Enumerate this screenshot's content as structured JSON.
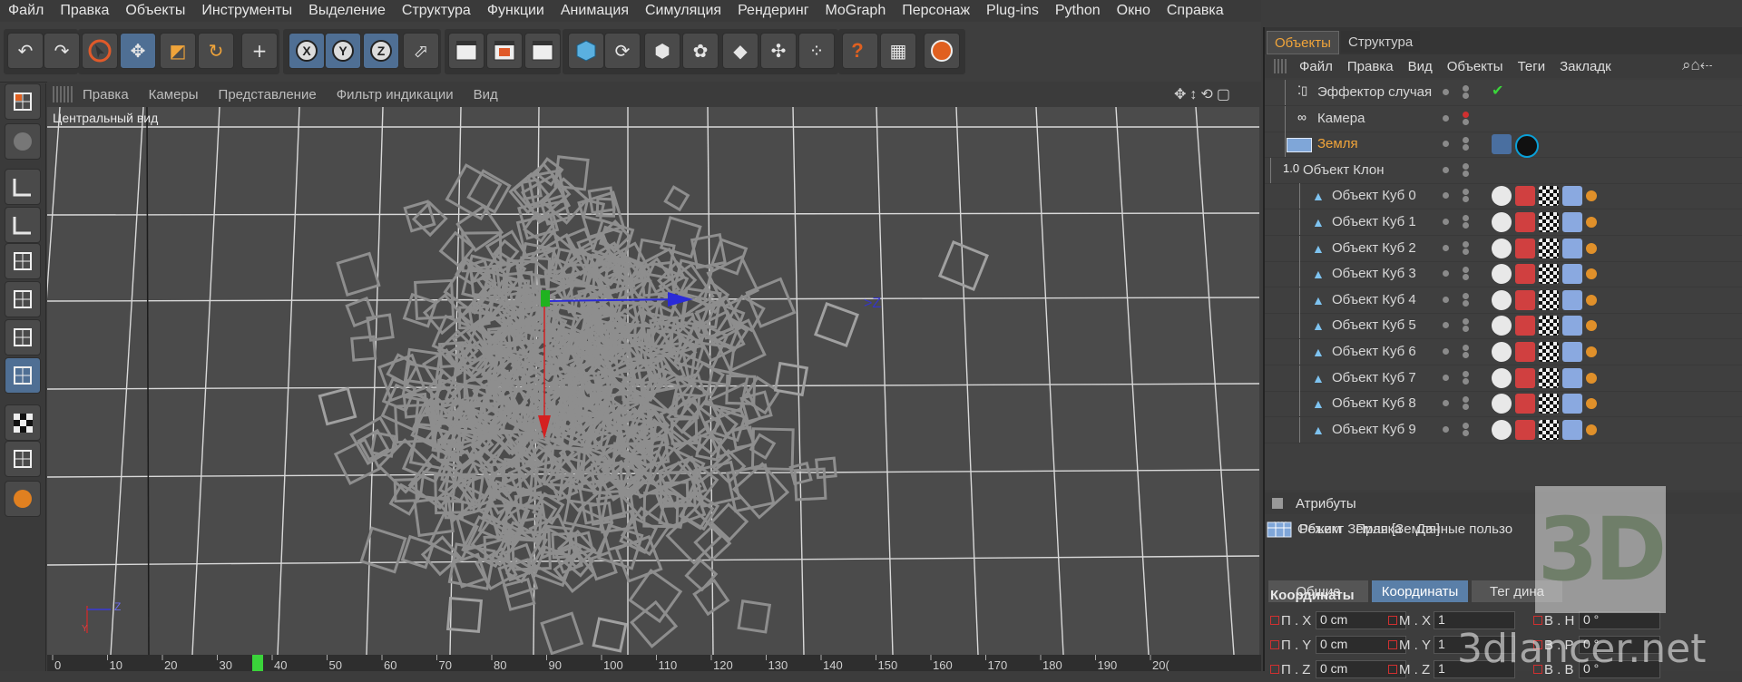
{
  "menubar": [
    "Файл",
    "Правка",
    "Объекты",
    "Инструменты",
    "Выделение",
    "Структура",
    "Функции",
    "Анимация",
    "Симуляция",
    "Рендеринг",
    "MoGraph",
    "Персонаж",
    "Plug-ins",
    "Python",
    "Окно",
    "Справка"
  ],
  "toolbar_icons": [
    "undo-icon",
    "redo-icon",
    "select-icon",
    "move-icon",
    "scale-icon",
    "rotate-icon",
    "add-icon",
    "x-axis-icon",
    "y-axis-icon",
    "z-axis-icon",
    "coordinate-system-icon",
    "render-view-icon",
    "render-picture-viewer-icon",
    "render-settings-icon",
    "cube-icon",
    "spline-icon",
    "nurbs-icon",
    "array-icon",
    "deformer-icon",
    "scene-icon",
    "particles-icon",
    "help-icon",
    "table-icon",
    "globe-icon"
  ],
  "viewport": {
    "menu": [
      "Правка",
      "Камеры",
      "Представление",
      "Фильтр индикации",
      "Вид"
    ],
    "label": "Центральный вид",
    "axis_gizmo": {
      "y": "Y",
      "z": "Z"
    }
  },
  "timeline": {
    "ticks": [
      "0",
      "10",
      "20",
      "30",
      "40",
      "50",
      "60",
      "70",
      "80",
      "90",
      "100",
      "110",
      "120",
      "130",
      "140",
      "150",
      "160",
      "170",
      "180",
      "190",
      "20("
    ],
    "current_frame_marker": "green"
  },
  "objects_panel": {
    "tabs": [
      "Объекты",
      "Структура"
    ],
    "menu": [
      "Файл",
      "Правка",
      "Вид",
      "Объекты",
      "Теги",
      "Закладк"
    ],
    "items": [
      {
        "name": "Эффектор случая",
        "indent": 1,
        "color": "#d7d7d7"
      },
      {
        "name": "Камера",
        "indent": 1,
        "color": "#d7d7d7"
      },
      {
        "name": "Земля",
        "indent": 1,
        "color": "#f0a43a"
      },
      {
        "name": "Объект Клон",
        "indent": 0,
        "color": "#d7d7d7"
      },
      {
        "name": "Объект Куб 0",
        "indent": 2,
        "color": "#d7d7d7"
      },
      {
        "name": "Объект Куб 1",
        "indent": 2,
        "color": "#d7d7d7"
      },
      {
        "name": "Объект Куб 2",
        "indent": 2,
        "color": "#d7d7d7"
      },
      {
        "name": "Объект Куб 3",
        "indent": 2,
        "color": "#d7d7d7"
      },
      {
        "name": "Объект Куб 4",
        "indent": 2,
        "color": "#d7d7d7"
      },
      {
        "name": "Объект Куб 5",
        "indent": 2,
        "color": "#d7d7d7"
      },
      {
        "name": "Объект Куб 6",
        "indent": 2,
        "color": "#d7d7d7"
      },
      {
        "name": "Объект Куб 7",
        "indent": 2,
        "color": "#d7d7d7"
      },
      {
        "name": "Объект Куб 8",
        "indent": 2,
        "color": "#d7d7d7"
      },
      {
        "name": "Объект Куб 9",
        "indent": 2,
        "color": "#d7d7d7"
      }
    ]
  },
  "attributes_panel": {
    "title": "Атрибуты",
    "menu": [
      "Режим",
      "Правка",
      "Данные пользо"
    ],
    "object_label": "Объект Земля [Земля]",
    "tabs": [
      "Общие",
      "Координаты",
      "Тег дина"
    ],
    "active_tab": "Координаты",
    "section": "Координаты",
    "rows": [
      {
        "p_label": "П . X",
        "p_value": "0 cm",
        "m_label": "М . X",
        "m_value": "1",
        "r_label": "В . H",
        "r_value": "0 °"
      },
      {
        "p_label": "П . Y",
        "p_value": "0 cm",
        "m_label": "М . Y",
        "m_value": "1",
        "r_label": "В . P",
        "r_value": "0 °"
      },
      {
        "p_label": "П . Z",
        "p_value": "0 cm",
        "m_label": "М . Z",
        "m_value": "1",
        "r_label": "В . B",
        "r_value": "0 °"
      }
    ]
  },
  "watermark": {
    "badge": "3D",
    "text": "3dlancer.net"
  },
  "colors": {
    "accent": "#f0a43a",
    "active_button": "#4f6f94",
    "viewport_bg": "#4b4b4b",
    "z_axis": "#2a2ad8",
    "y_axis": "#1fb21f",
    "x_axis": "#d42020"
  }
}
